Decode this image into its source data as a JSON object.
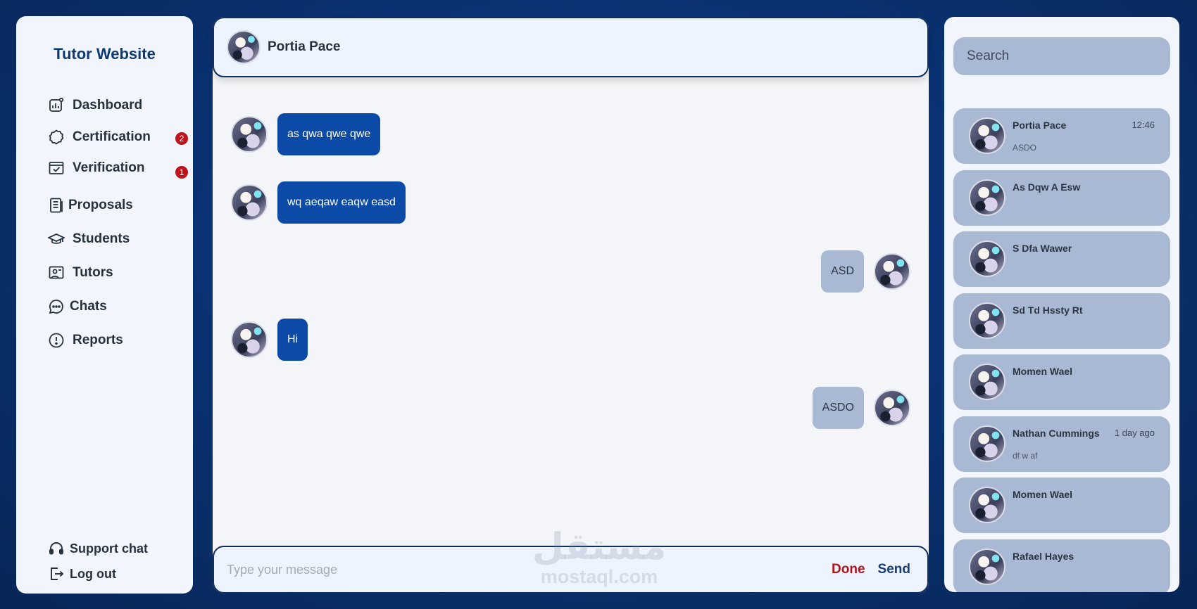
{
  "sidebar": {
    "brand": "Tutor Website",
    "items": [
      {
        "label": "Dashboard",
        "icon": "dashboard-icon"
      },
      {
        "label": "Certification",
        "icon": "certificate-icon",
        "badge": "2"
      },
      {
        "label": "Verification",
        "icon": "verification-icon",
        "badge": "1"
      },
      {
        "label": "Proposals",
        "icon": "document-icon"
      },
      {
        "label": "Students",
        "icon": "graduation-cap-icon"
      },
      {
        "label": "Tutors",
        "icon": "tutor-board-icon"
      },
      {
        "label": "Chats",
        "icon": "chat-bubble-icon"
      },
      {
        "label": "Reports",
        "icon": "alert-circle-icon"
      }
    ],
    "footer": [
      {
        "label": "Support chat",
        "icon": "headset-icon"
      },
      {
        "label": "Log out",
        "icon": "logout-icon"
      }
    ]
  },
  "chat": {
    "contact_name": "Portia Pace",
    "messages": [
      {
        "text": "as qwa qwe qwe",
        "direction": "in"
      },
      {
        "text": "wq aeqaw eaqw easd",
        "direction": "in"
      },
      {
        "text": "ASD",
        "direction": "out"
      },
      {
        "text": "Hi",
        "direction": "in"
      },
      {
        "text": "ASDO",
        "direction": "out"
      }
    ],
    "composer": {
      "placeholder": "Type your message",
      "done_label": "Done",
      "send_label": "Send"
    }
  },
  "watermark": {
    "arabic": "مستقل",
    "latin": "mostaql.com"
  },
  "conversations": {
    "search_placeholder": "Search",
    "items": [
      {
        "name": "Portia Pace",
        "time": "12:46",
        "preview": "ASDO"
      },
      {
        "name": "As Dqw A Esw",
        "time": "",
        "preview": ""
      },
      {
        "name": "S Dfa Wawer",
        "time": "",
        "preview": ""
      },
      {
        "name": "Sd Td Hssty Rt",
        "time": "",
        "preview": ""
      },
      {
        "name": "Momen Wael",
        "time": "",
        "preview": ""
      },
      {
        "name": "Nathan Cummings",
        "time": "1 day ago",
        "preview": "df w af"
      },
      {
        "name": "Momen Wael",
        "time": "",
        "preview": ""
      },
      {
        "name": "Rafael Hayes",
        "time": "",
        "preview": ""
      }
    ]
  },
  "colors": {
    "background": "#0a3375",
    "accent": "#0c4aa8",
    "badge": "#c0121b",
    "done": "#b3121b",
    "card": "#a9b9d4"
  }
}
